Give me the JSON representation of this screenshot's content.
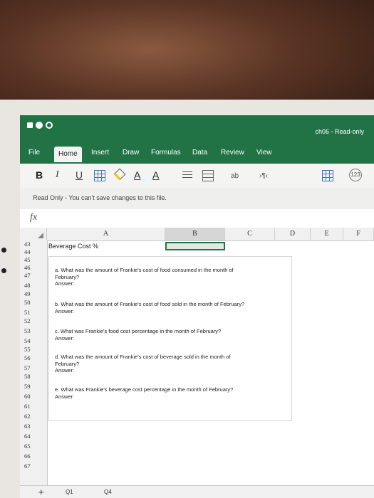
{
  "window": {
    "title": "ch06 - Read-only"
  },
  "tabs": [
    "File",
    "Home",
    "Insert",
    "Draw",
    "Formulas",
    "Data",
    "Review",
    "View"
  ],
  "ribbon": {
    "bold": "B",
    "italic": "I",
    "underline": "U",
    "font_color": "A",
    "font_size_up": "A",
    "wrap": "ab",
    "number": "123"
  },
  "notice": "Read Only - You can't save changes to this file.",
  "formula_bar": {
    "fx_label": "fx",
    "value": ""
  },
  "columns": [
    "A",
    "B",
    "C",
    "D",
    "E",
    "F"
  ],
  "rows": [
    "43",
    "44",
    "45",
    "46",
    "47",
    "48",
    "49",
    "50",
    "51",
    "52",
    "53",
    "54",
    "55",
    "56",
    "57",
    "58",
    "59",
    "60",
    "61",
    "62",
    "63",
    "64",
    "65",
    "66",
    "67"
  ],
  "cells": {
    "A43": "Beverage Cost %"
  },
  "questions": [
    {
      "line1": "a. What was the amount of Frankie's cost of food consumed in the month of",
      "line2": "February?",
      "answer": "Answer:"
    },
    {
      "line1": "b. What was the amount of Frankie's cost of food sold in the month of February?",
      "line2": "",
      "answer": "Answer:"
    },
    {
      "line1": "c. What was Frankie's food cost percentage in the month of February?",
      "line2": "",
      "answer": "Answer:"
    },
    {
      "line1": "d. What was the amount of Frankie's cost of beverage sold in the month of",
      "line2": "February?",
      "answer": "Answer:"
    },
    {
      "line1": "e. What was Frankie's beverage cost percentage in the month of February?",
      "line2": "",
      "answer": "Answer:"
    }
  ],
  "sheet_tabs": [
    "Q1",
    "Q4"
  ],
  "add_sheet": "+",
  "colors": {
    "accent": "#217346",
    "selection": "#d6d6d6"
  }
}
